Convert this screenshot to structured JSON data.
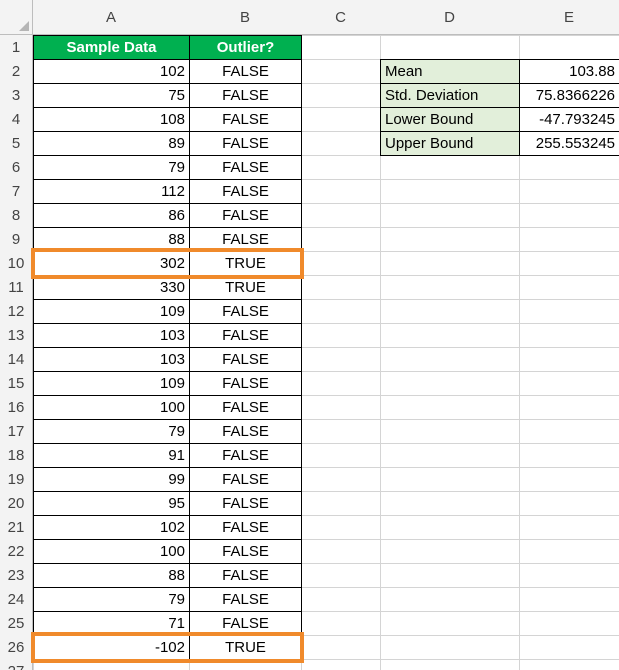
{
  "columns": [
    "A",
    "B",
    "C",
    "D",
    "E"
  ],
  "rows": [
    "1",
    "2",
    "3",
    "4",
    "5",
    "6",
    "7",
    "8",
    "9",
    "10",
    "11",
    "12",
    "13",
    "14",
    "15",
    "16",
    "17",
    "18",
    "19",
    "20",
    "21",
    "22",
    "23",
    "24",
    "25",
    "26",
    "27"
  ],
  "table": {
    "headers": [
      "Sample Data",
      "Outlier?"
    ],
    "values": [
      102,
      75,
      108,
      89,
      79,
      112,
      86,
      88,
      302,
      330,
      109,
      103,
      103,
      109,
      100,
      79,
      91,
      99,
      95,
      102,
      100,
      88,
      79,
      71,
      -102
    ],
    "flags": [
      "FALSE",
      "FALSE",
      "FALSE",
      "FALSE",
      "FALSE",
      "FALSE",
      "FALSE",
      "FALSE",
      "TRUE",
      "TRUE",
      "FALSE",
      "FALSE",
      "FALSE",
      "FALSE",
      "FALSE",
      "FALSE",
      "FALSE",
      "FALSE",
      "FALSE",
      "FALSE",
      "FALSE",
      "FALSE",
      "FALSE",
      "FALSE",
      "TRUE"
    ]
  },
  "stats": [
    {
      "label": "Mean",
      "value": "103.88"
    },
    {
      "label": "Std. Deviation",
      "value": "75.8366226"
    },
    {
      "label": "Lower Bound",
      "value": "-47.793245"
    },
    {
      "label": "Upper Bound",
      "value": "255.553245"
    }
  ],
  "highlighted_rows": [
    10,
    26
  ],
  "colors": {
    "header_fill": "#00b050",
    "stat_fill": "#e2efda",
    "highlight_border": "#f08a2b"
  }
}
